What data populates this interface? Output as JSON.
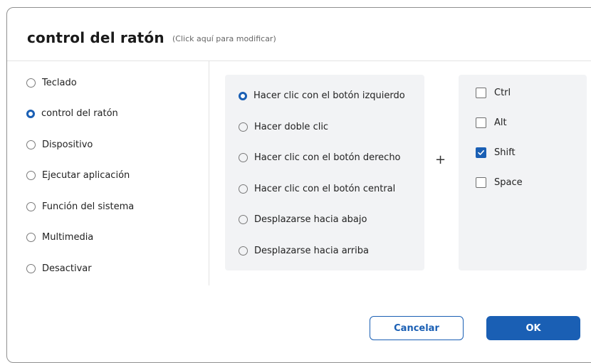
{
  "header": {
    "title": "control del ratón",
    "subtitle": "(Click aquí para modificar)"
  },
  "sidebar": {
    "items": [
      {
        "label": "Teclado",
        "selected": false
      },
      {
        "label": "control del ratón",
        "selected": true
      },
      {
        "label": "Dispositivo",
        "selected": false
      },
      {
        "label": "Ejecutar aplicación",
        "selected": false
      },
      {
        "label": "Función del sistema",
        "selected": false
      },
      {
        "label": "Multimedia",
        "selected": false
      },
      {
        "label": "Desactivar",
        "selected": false
      }
    ]
  },
  "actions": {
    "items": [
      {
        "label": "Hacer clic con el botón izquierdo",
        "selected": true
      },
      {
        "label": "Hacer doble clic",
        "selected": false
      },
      {
        "label": "Hacer clic con el botón derecho",
        "selected": false
      },
      {
        "label": "Hacer clic con el botón central",
        "selected": false
      },
      {
        "label": "Desplazarse hacia abajo",
        "selected": false
      },
      {
        "label": "Desplazarse hacia arriba",
        "selected": false
      }
    ]
  },
  "combine_symbol": "+",
  "modifiers": {
    "items": [
      {
        "label": "Ctrl",
        "checked": false
      },
      {
        "label": "Alt",
        "checked": false
      },
      {
        "label": "Shift",
        "checked": true
      },
      {
        "label": "Space",
        "checked": false
      }
    ]
  },
  "footer": {
    "cancel_label": "Cancelar",
    "ok_label": "OK"
  },
  "colors": {
    "accent": "#1a5fb4",
    "panel_bg": "#f2f3f5",
    "border": "#8f8f8f"
  },
  "icons": {
    "radio": "radio-button-icon",
    "checkbox": "checkbox-icon",
    "checkmark": "checkmark-icon",
    "plus": "plus-icon"
  }
}
